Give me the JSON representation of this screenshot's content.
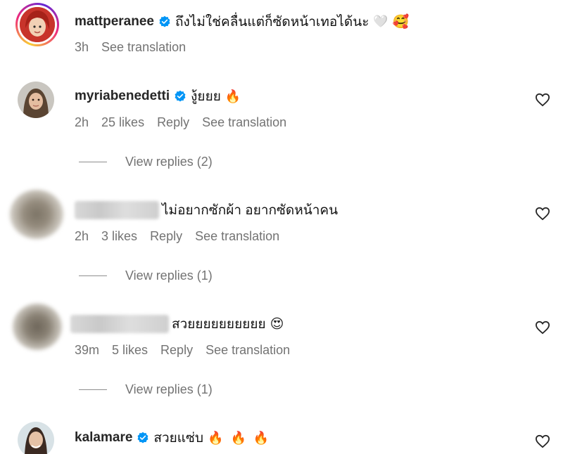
{
  "comments": [
    {
      "username": "mattperanee",
      "verified": true,
      "text": "ถึงไม่ใช่คลื่นแต่ก็ซัดหน้าเทอได้นะ",
      "emojis": [
        "🤍",
        "🥰"
      ],
      "time": "3h",
      "see_translation": "See translation"
    },
    {
      "username": "myriabenedetti",
      "verified": true,
      "text": "งู้ยยย",
      "emojis": [
        "🔥"
      ],
      "time": "2h",
      "likes": "25 likes",
      "reply": "Reply",
      "see_translation": "See translation",
      "view_replies": "View replies (2)"
    },
    {
      "username": "",
      "verified": false,
      "text": "ไม่อยากซักผ้า อยากซัดหน้าคน",
      "emojis": [],
      "time": "2h",
      "likes": "3 likes",
      "reply": "Reply",
      "see_translation": "See translation",
      "view_replies": "View replies (1)"
    },
    {
      "username": "",
      "verified": false,
      "text": "สวยยยยยยยยยย",
      "emojis": [
        "😍"
      ],
      "time": "39m",
      "likes": "5 likes",
      "reply": "Reply",
      "see_translation": "See translation",
      "view_replies": "View replies (1)"
    },
    {
      "username": "kalamare",
      "verified": true,
      "text": "สวยแซ่บ",
      "emojis": [
        "🔥",
        "🔥",
        "🔥"
      ]
    }
  ],
  "colors": {
    "verified_blue": "#0095f6",
    "secondary_text": "#737373",
    "primary_text": "#262626"
  },
  "icons": {
    "like": "heart-outline-icon",
    "verified": "verified-badge-icon"
  }
}
